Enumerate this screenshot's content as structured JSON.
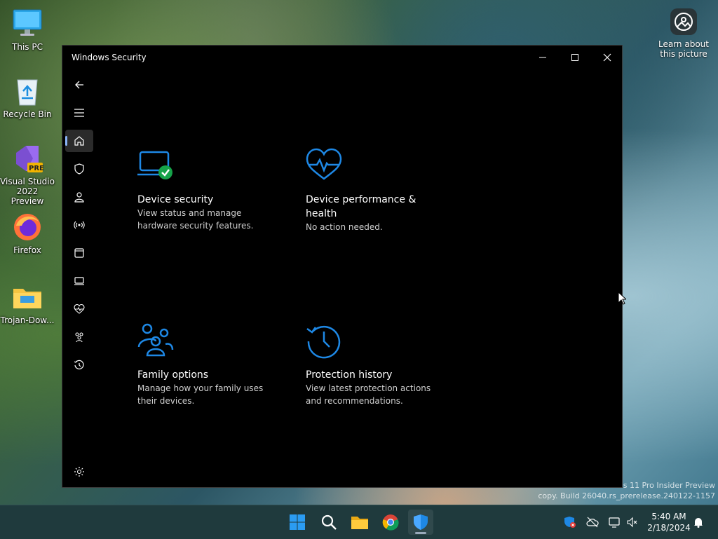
{
  "desktop": {
    "icons": [
      {
        "label": "This PC"
      },
      {
        "label": "Recycle Bin"
      },
      {
        "label": "Visual Studio 2022 Preview",
        "badge": "PRE"
      },
      {
        "label": "Firefox"
      },
      {
        "label": "Trojan-Dow..."
      }
    ],
    "learn_label": "Learn about this picture",
    "watermark_line1": "s 11 Pro Insider Preview",
    "watermark_line2": "copy. Build 26040.rs_prerelease.240122-1157"
  },
  "window": {
    "title": "Windows Security",
    "tiles": [
      {
        "title": "Device security",
        "desc": "View status and manage hardware security features."
      },
      {
        "title": "Device performance & health",
        "desc": "No action needed."
      },
      {
        "title": "Family options",
        "desc": "Manage how your family uses their devices."
      },
      {
        "title": "Protection history",
        "desc": "View latest protection actions and recommendations."
      }
    ]
  },
  "taskbar": {
    "time": "5:40 AM",
    "date": "2/18/2024"
  },
  "colors": {
    "accent_blue": "#1e88e5",
    "success_green": "#16a34a",
    "window_bg": "#000000",
    "taskbar_bg": "#1f3a3d"
  }
}
